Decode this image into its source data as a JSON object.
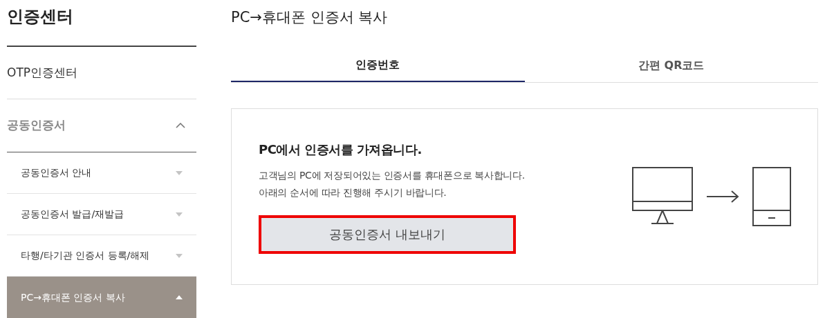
{
  "sidebar": {
    "title": "인증센터",
    "items": [
      {
        "label": "OTP인증센터",
        "kind": "link"
      },
      {
        "label": "공동인증서",
        "kind": "group",
        "expanded": true,
        "children": [
          {
            "label": "공동인증서 안내",
            "selected": false
          },
          {
            "label": "공동인증서 발급/재발급",
            "selected": false
          },
          {
            "label": "타행/타기관 인증서 등록/해제",
            "selected": false
          },
          {
            "label": "PC→휴대폰 인증서 복사",
            "selected": true
          }
        ]
      }
    ]
  },
  "main": {
    "title": "PC→휴대폰 인증서 복사",
    "tabs": [
      {
        "label": "인증번호",
        "selected": true
      },
      {
        "label": "간편 QR코드",
        "selected": false
      }
    ],
    "card": {
      "heading": "PC에서 인증서를 가져옵니다.",
      "lines": [
        "고객님의 PC에 저장되어있는 인증서를 휴대폰으로 복사합니다.",
        "아래의 순서에 따라 진행해 주시기 바랍니다."
      ],
      "button": {
        "label": "공동인증서 내보내기",
        "highlighted": true
      }
    }
  }
}
